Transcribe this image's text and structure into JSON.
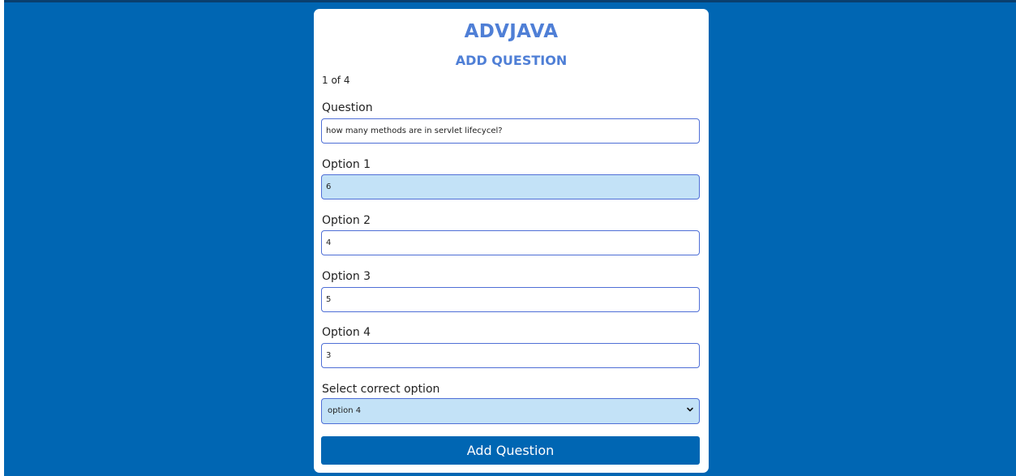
{
  "header": {
    "app_title": "ADVJAVA",
    "page_heading": "ADD QUESTION",
    "counter": "1 of 4"
  },
  "form": {
    "question": {
      "label": "Question",
      "value": "how many methods are in servlet lifecycel?"
    },
    "option1": {
      "label": "Option 1",
      "value": "6"
    },
    "option2": {
      "label": "Option 2",
      "value": "4"
    },
    "option3": {
      "label": "Option 3",
      "value": "5"
    },
    "option4": {
      "label": "Option 4",
      "value": "3"
    },
    "correct_option": {
      "label": "Select correct option",
      "selected": "option 4",
      "icon": "chevron-down-icon"
    },
    "submit_label": "Add Question"
  },
  "colors": {
    "background": "#0066b3",
    "heading": "#4f7fd6",
    "input_border": "#4f6fd6",
    "input_filled": "#c3e2f7",
    "button": "#0066b3"
  }
}
